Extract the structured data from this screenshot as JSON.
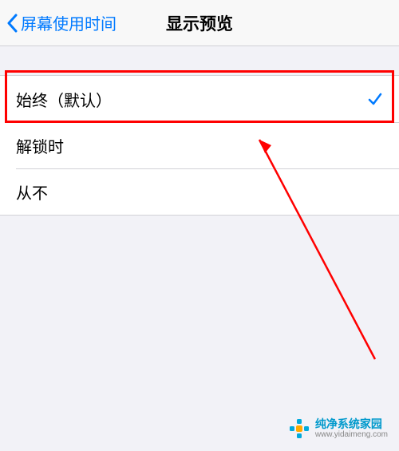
{
  "nav": {
    "back_label": "屏幕使用时间",
    "title": "显示预览"
  },
  "options": [
    {
      "label": "始终（默认）",
      "selected": true
    },
    {
      "label": "解锁时",
      "selected": false
    },
    {
      "label": "从不",
      "selected": false
    }
  ],
  "annotation": {
    "highlight_color": "#ff0000",
    "arrow_color": "#ff0000"
  },
  "watermark": {
    "title": "纯净系统家园",
    "url": "www.yidaimeng.com",
    "brand_color": "#0099cc"
  }
}
